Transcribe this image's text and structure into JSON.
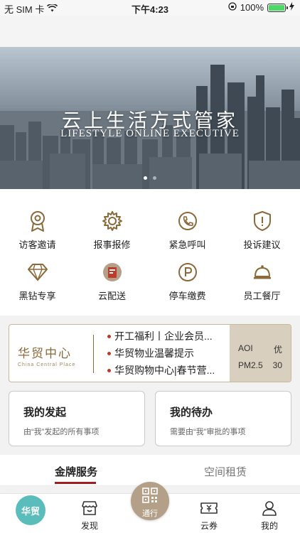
{
  "status_bar": {
    "carrier": "无 SIM 卡",
    "time": "下午4:23",
    "battery": "100%",
    "battery_level": 1.0
  },
  "banner": {
    "title_cn": "云上生活方式管家",
    "title_en": "LIFESTYLE ONLINE EXECUTIVE",
    "slide_count": 2,
    "active_slide": 0
  },
  "services": [
    {
      "label": "访客邀请",
      "icon": "visitor-badge-icon"
    },
    {
      "label": "报事报修",
      "icon": "gear-icon"
    },
    {
      "label": "紧急呼叫",
      "icon": "phone-call-icon"
    },
    {
      "label": "投诉建议",
      "icon": "warning-shield-icon"
    },
    {
      "label": "黑钻专享",
      "icon": "diamond-icon"
    },
    {
      "label": "云配送",
      "icon": "delivery-icon"
    },
    {
      "label": "停车缴费",
      "icon": "parking-icon"
    },
    {
      "label": "员工餐厅",
      "icon": "cloche-icon"
    }
  ],
  "info_card": {
    "logo_cn": "华贸中心",
    "logo_en": "China Central Place",
    "news": [
      "开工福利丨企业会员...",
      "华贸物业温馨提示",
      "华贸购物中心|春节营..."
    ],
    "aqi": {
      "aqi_label": "AOI",
      "aqi_value": "优",
      "pm_label": "PM2.5",
      "pm_value": "30"
    }
  },
  "my_initiated": {
    "title": "我的发起",
    "subtitle": "由“我”发起的所有事项"
  },
  "my_todo": {
    "title": "我的待办",
    "subtitle": "需要由“我”审批的事项"
  },
  "tabs": [
    "金牌服务",
    "空间租赁"
  ],
  "bottom_nav": {
    "home": "华贸",
    "discover": "发现",
    "pass": "通行",
    "coupon": "云券",
    "mine": "我的"
  },
  "colors": {
    "accent": "#a01e1e",
    "gold": "#8b6a3a",
    "teal": "#5bbcbc",
    "pass_bg": "#b4a089"
  }
}
